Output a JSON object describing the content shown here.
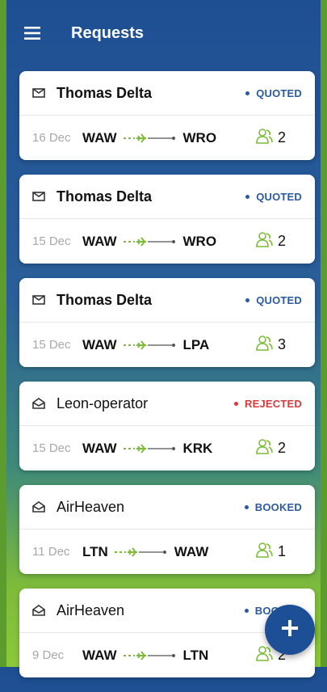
{
  "app": {
    "title": "Requests"
  },
  "colors": {
    "header_blue": "#1f4f93",
    "accent_green": "#7dbb3a",
    "quoted": "#2b5aa0",
    "rejected": "#d63a3a",
    "booked": "#2b5aa0"
  },
  "icons": {
    "menu": "hamburger-icon",
    "unread": "envelope-closed-icon",
    "read": "envelope-open-icon",
    "route": "airplane-route-icon",
    "passengers": "passengers-icon",
    "add": "plus-icon"
  },
  "requests": [
    {
      "name": "Thomas Delta",
      "status": "QUOTED",
      "date": "16 Dec",
      "from": "WAW",
      "to": "WRO",
      "pax": "2"
    },
    {
      "name": "Thomas Delta",
      "status": "QUOTED",
      "date": "15 Dec",
      "from": "WAW",
      "to": "WRO",
      "pax": "2"
    },
    {
      "name": "Thomas Delta",
      "status": "QUOTED",
      "date": "15 Dec",
      "from": "WAW",
      "to": "LPA",
      "pax": "3"
    },
    {
      "name": "Leon-operator",
      "status": "REJECTED",
      "date": "15 Dec",
      "from": "WAW",
      "to": "KRK",
      "pax": "2"
    },
    {
      "name": "AirHeaven",
      "status": "BOOKED",
      "date": "11 Dec",
      "from": "LTN",
      "to": "WAW",
      "pax": "1"
    },
    {
      "name": "AirHeaven",
      "status": "BOOKED",
      "date": "9 Dec",
      "from": "WAW",
      "to": "LTN",
      "pax": "2"
    }
  ]
}
